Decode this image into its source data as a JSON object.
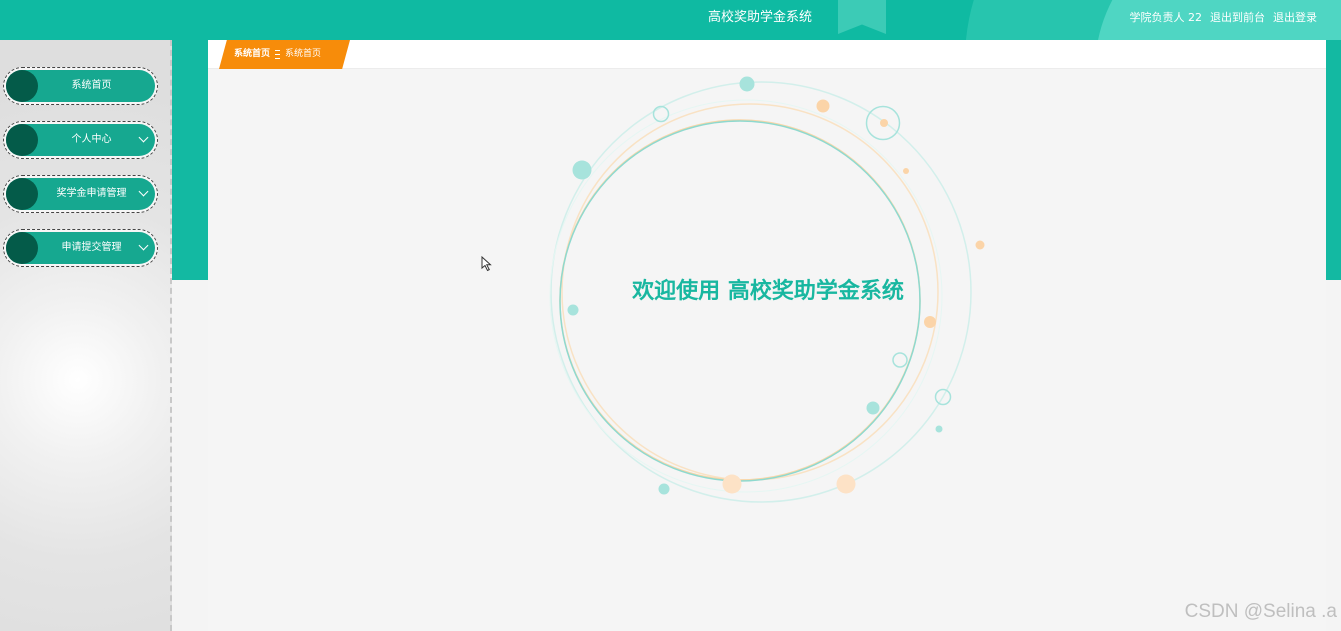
{
  "header": {
    "title": "高校奖助学金系统",
    "user_label": "学院负责人 22",
    "links": [
      "退出到前台",
      "退出登录"
    ]
  },
  "sidebar": {
    "items": [
      {
        "label": "系统首页",
        "has_submenu": false
      },
      {
        "label": "个人中心",
        "has_submenu": true
      },
      {
        "label": "奖学金申请管理",
        "has_submenu": true
      },
      {
        "label": "申请提交管理",
        "has_submenu": true
      }
    ]
  },
  "breadcrumb": {
    "home": "系统首页",
    "current": "系统首页"
  },
  "welcome": {
    "text": "欢迎使用 高校奖助学金系统"
  },
  "watermark": "CSDN @Selina .a",
  "colors": {
    "primary": "#0fbaa2",
    "menu_pill": "#16a890",
    "menu_bullet": "#045b49",
    "breadcrumb": "#f78c0a",
    "welcome_text": "#19b7a0",
    "ring_teal": "#8ed9cf",
    "ring_orange": "#f8d6a8"
  },
  "icons": {
    "submenu": "chevron-down-icon",
    "cursor": "mouse-pointer-icon"
  }
}
